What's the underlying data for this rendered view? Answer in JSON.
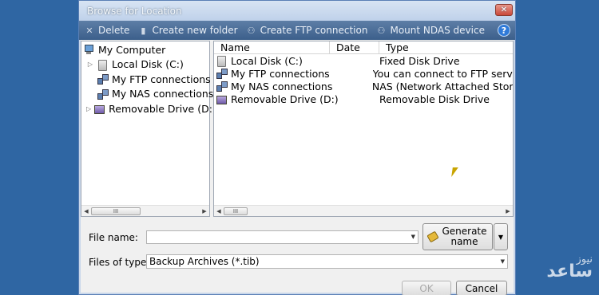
{
  "window": {
    "title": "Browse for Location"
  },
  "toolbar": {
    "delete": "Delete",
    "create_folder": "Create new folder",
    "create_ftp": "Create FTP connection",
    "mount_ndas": "Mount NDAS device",
    "help": "?"
  },
  "tree": {
    "root": "My Computer",
    "items": [
      {
        "label": "Local Disk (C:)",
        "icon": "disk-icon",
        "expandable": true
      },
      {
        "label": "My FTP connections",
        "icon": "ftp-icon",
        "expandable": false
      },
      {
        "label": "My NAS connections",
        "icon": "nas-icon",
        "expandable": false
      },
      {
        "label": "Removable Drive (D:)",
        "icon": "removable-drive-icon",
        "expandable": true
      }
    ]
  },
  "list": {
    "columns": [
      "Name",
      "Date",
      "Type"
    ],
    "rows": [
      {
        "name": "Local Disk (C:)",
        "date": "",
        "type": "Fixed Disk Drive",
        "icon": "disk-icon"
      },
      {
        "name": "My FTP connections",
        "date": "",
        "type": "You can connect to FTP serve",
        "icon": "ftp-icon"
      },
      {
        "name": "My NAS connections",
        "date": "",
        "type": "NAS (Network Attached Stora",
        "icon": "nas-icon"
      },
      {
        "name": "Removable Drive (D:)",
        "date": "",
        "type": "Removable Disk Drive",
        "icon": "removable-drive-icon"
      }
    ]
  },
  "scroll": {
    "thumb_grip": "III"
  },
  "form": {
    "file_name_label": "File name:",
    "file_name_value": "",
    "generate_label_1": "Generate",
    "generate_label_2": "name",
    "file_type_label": "Files of type:",
    "file_type_value": "Backup Archives (*.tib)",
    "ok": "OK",
    "cancel": "Cancel"
  },
  "watermark": {
    "line1": "نیوز",
    "line2": "ساعد"
  }
}
